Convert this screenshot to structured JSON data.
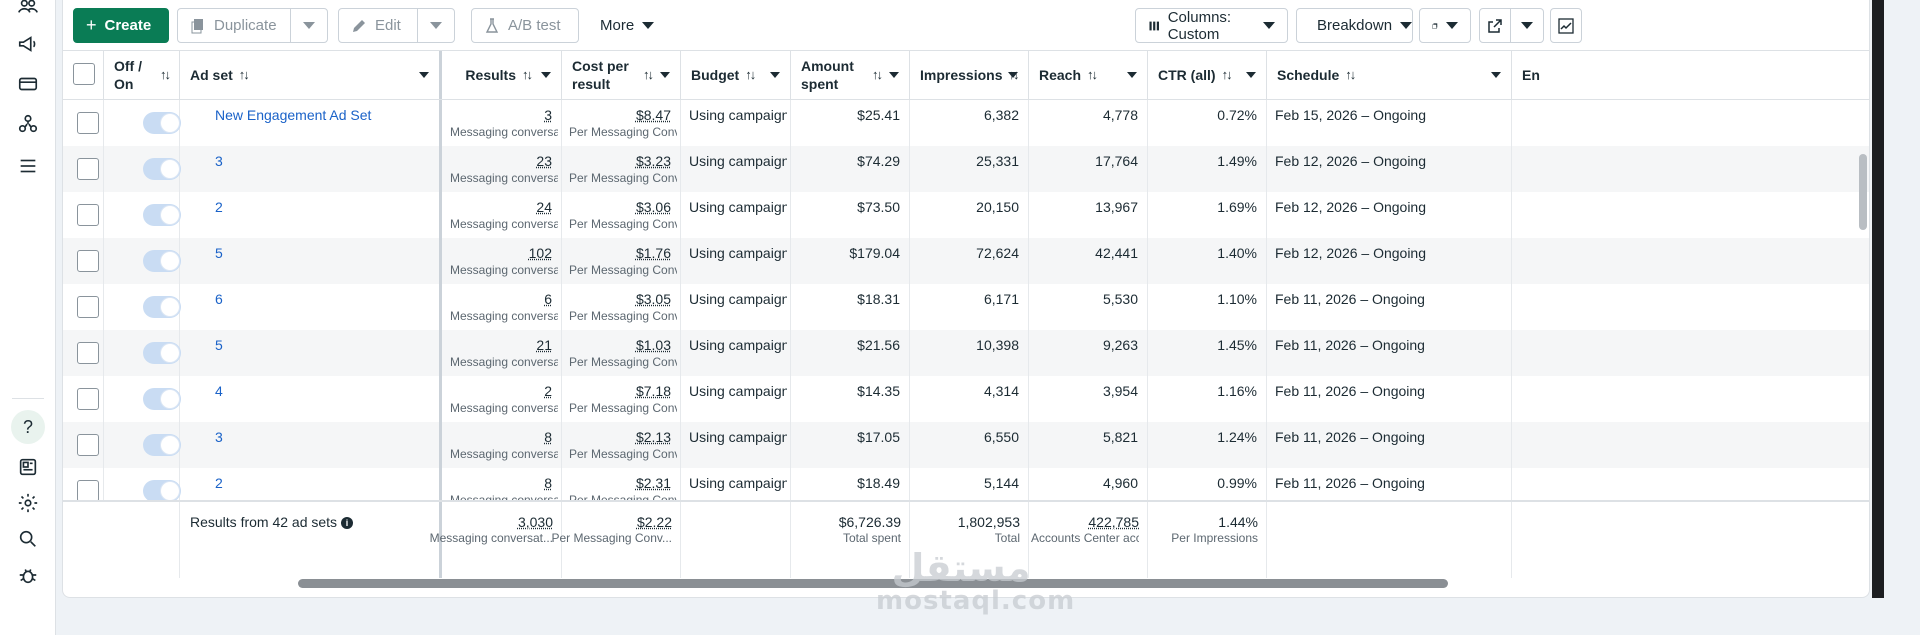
{
  "toolbar": {
    "create": "Create",
    "duplicate": "Duplicate",
    "edit": "Edit",
    "ab_test": "A/B test",
    "more": "More",
    "columns": "Columns: Custom",
    "breakdown": "Breakdown"
  },
  "columns": {
    "off_on": "Off / On",
    "ad_set": "Ad set",
    "results": "Results",
    "cost_per_result": "Cost per result",
    "budget": "Budget",
    "amount_spent": "Amount spent",
    "impressions": "Impressions",
    "reach": "Reach",
    "ctr": "CTR (all)",
    "schedule": "Schedule",
    "ends": "En"
  },
  "rows": [
    {
      "name": "New Engagement Ad Set",
      "results": "3",
      "results_sub": "Messaging conversat...",
      "cpr": "$8.47",
      "cpr_sub": "Per Messaging Conv...",
      "budget": "Using campaign...",
      "spent": "$25.41",
      "impressions": "6,382",
      "reach": "4,778",
      "ctr": "0.72%",
      "schedule": "Feb 15, 2026 – Ongoing"
    },
    {
      "name": "3",
      "results": "23",
      "results_sub": "Messaging conversat...",
      "cpr": "$3.23",
      "cpr_sub": "Per Messaging Conv...",
      "budget": "Using campaign...",
      "spent": "$74.29",
      "impressions": "25,331",
      "reach": "17,764",
      "ctr": "1.49%",
      "schedule": "Feb 12, 2026 – Ongoing"
    },
    {
      "name": "2",
      "results": "24",
      "results_sub": "Messaging conversat...",
      "cpr": "$3.06",
      "cpr_sub": "Per Messaging Conv...",
      "budget": "Using campaign...",
      "spent": "$73.50",
      "impressions": "20,150",
      "reach": "13,967",
      "ctr": "1.69%",
      "schedule": "Feb 12, 2026 – Ongoing"
    },
    {
      "name": "5",
      "results": "102",
      "results_sub": "Messaging conversat...",
      "cpr": "$1.76",
      "cpr_sub": "Per Messaging Conv...",
      "budget": "Using campaign...",
      "spent": "$179.04",
      "impressions": "72,624",
      "reach": "42,441",
      "ctr": "1.40%",
      "schedule": "Feb 12, 2026 – Ongoing"
    },
    {
      "name": "6",
      "results": "6",
      "results_sub": "Messaging conversat...",
      "cpr": "$3.05",
      "cpr_sub": "Per Messaging Conv...",
      "budget": "Using campaign...",
      "spent": "$18.31",
      "impressions": "6,171",
      "reach": "5,530",
      "ctr": "1.10%",
      "schedule": "Feb 11, 2026 – Ongoing"
    },
    {
      "name": "5",
      "results": "21",
      "results_sub": "Messaging conversat...",
      "cpr": "$1.03",
      "cpr_sub": "Per Messaging Conv...",
      "budget": "Using campaign...",
      "spent": "$21.56",
      "impressions": "10,398",
      "reach": "9,263",
      "ctr": "1.45%",
      "schedule": "Feb 11, 2026 – Ongoing"
    },
    {
      "name": "4",
      "results": "2",
      "results_sub": "Messaging conversat...",
      "cpr": "$7.18",
      "cpr_sub": "Per Messaging Conv...",
      "budget": "Using campaign...",
      "spent": "$14.35",
      "impressions": "4,314",
      "reach": "3,954",
      "ctr": "1.16%",
      "schedule": "Feb 11, 2026 – Ongoing"
    },
    {
      "name": "3",
      "results": "8",
      "results_sub": "Messaging conversat...",
      "cpr": "$2.13",
      "cpr_sub": "Per Messaging Conv...",
      "budget": "Using campaign...",
      "spent": "$17.05",
      "impressions": "6,550",
      "reach": "5,821",
      "ctr": "1.24%",
      "schedule": "Feb 11, 2026 – Ongoing"
    },
    {
      "name": "2",
      "results": "8",
      "results_sub": "Messaging conversat...",
      "cpr": "$2.31",
      "cpr_sub": "Per Messaging Conv...",
      "budget": "Using campaign...",
      "spent": "$18.49",
      "impressions": "5,144",
      "reach": "4,960",
      "ctr": "0.99%",
      "schedule": "Feb 11, 2026 – Ongoing"
    }
  ],
  "totals": {
    "label": "Results from 42 ad sets",
    "results": "3,030",
    "results_sub": "Messaging conversat...",
    "cpr": "$2.22",
    "cpr_sub": "Per Messaging Conv...",
    "spent": "$6,726.39",
    "spent_sub": "Total spent",
    "impressions": "1,802,953",
    "impressions_sub": "Total",
    "reach": "422,785",
    "reach_sub": "Accounts Center acco...",
    "ctr": "1.44%",
    "ctr_sub": "Per Impressions"
  },
  "watermark": {
    "arabic": "مستقل",
    "latin": "mostaql.com"
  },
  "colors": {
    "accent": "#0a7c55",
    "link": "#1a62c8",
    "toggle": "#c9dcf3"
  }
}
